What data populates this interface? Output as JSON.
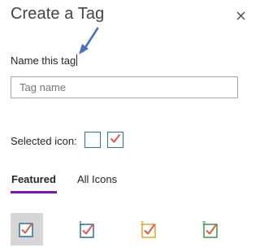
{
  "dialog": {
    "title": "Create a Tag",
    "close_glyph": "×"
  },
  "name_field": {
    "label": "Name this tag",
    "placeholder": "Tag name",
    "value": ""
  },
  "selected_icon": {
    "label": "Selected icon:",
    "icons": [
      "empty-checkbox-icon",
      "checked-checkbox-icon"
    ]
  },
  "tabs": [
    {
      "label": "Featured",
      "active": true
    },
    {
      "label": "All Icons",
      "active": false
    }
  ],
  "featured_icons": [
    {
      "name": "checkbox-icon",
      "badge": "",
      "box_color": "#2e6f9e",
      "selected": true
    },
    {
      "name": "checkbox-1-icon",
      "badge": "1",
      "box_color": "#2e6f9e",
      "selected": false
    },
    {
      "name": "checkbox-2-icon",
      "badge": "2",
      "box_color": "#e3a52b",
      "selected": false
    },
    {
      "name": "checkbox-3-icon",
      "badge": "3",
      "box_color": "#3a9a48",
      "selected": false
    }
  ],
  "colors": {
    "accent": "#7719aa",
    "checkmark": "#e05a4e",
    "cursor_arrow": "#4472c4"
  }
}
